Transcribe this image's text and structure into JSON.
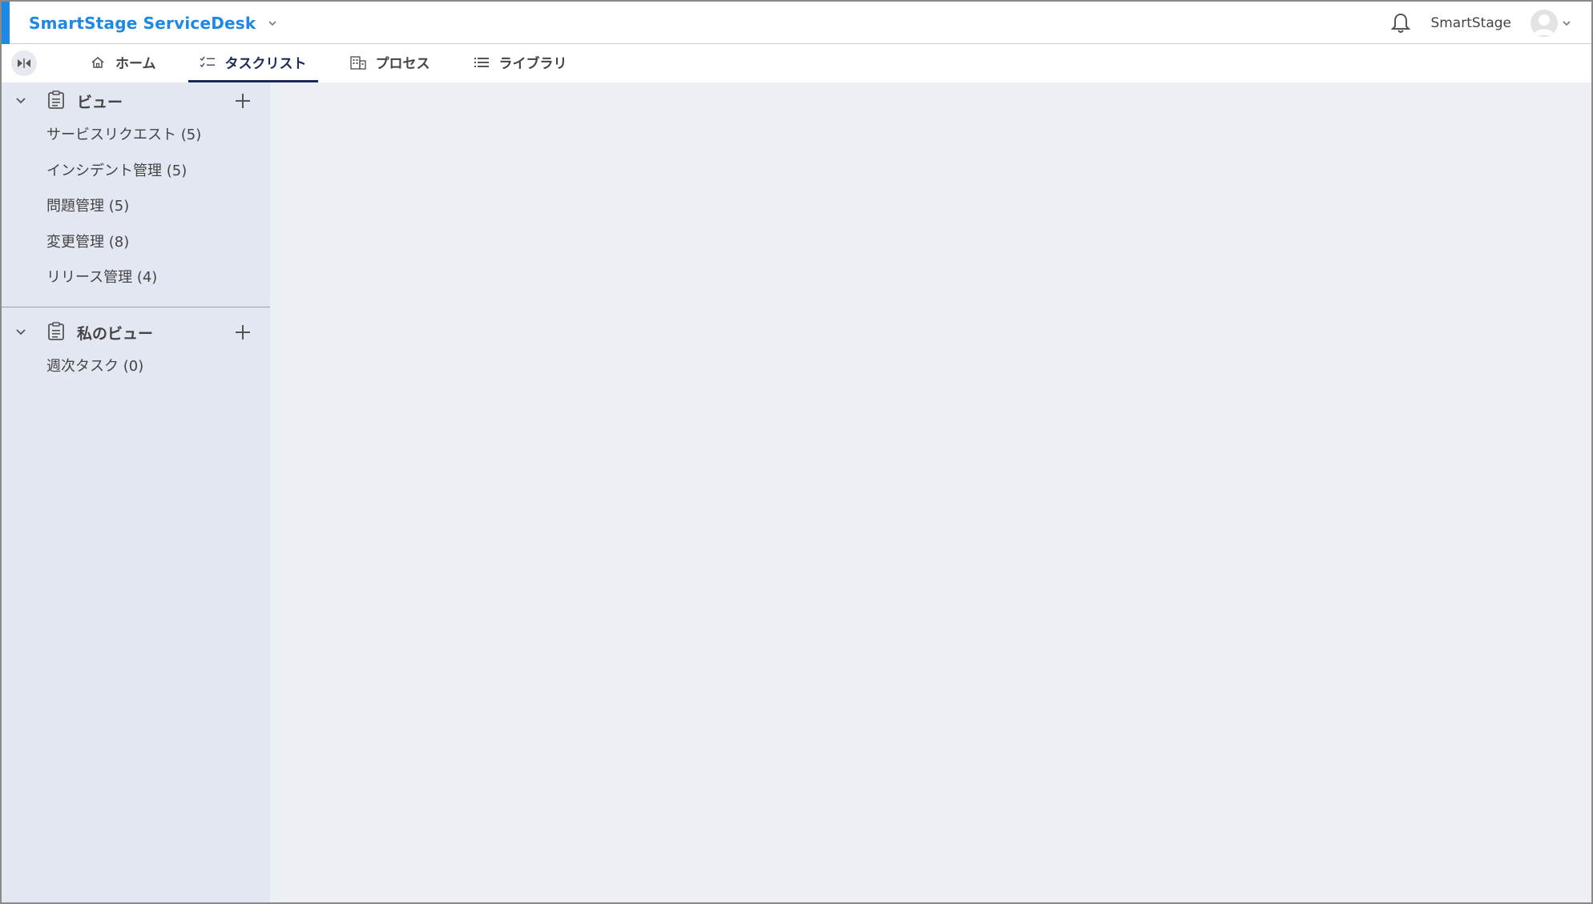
{
  "app": {
    "title": "SmartStage ServiceDesk",
    "accent_color": "#1e88e5"
  },
  "header": {
    "notification_icon": "bell-icon",
    "username": "SmartStage",
    "avatar_icon": "user-avatar-icon"
  },
  "tabs": [
    {
      "label": "ホーム",
      "icon": "home-icon",
      "active": false
    },
    {
      "label": "タスクリスト",
      "icon": "checklist-icon",
      "active": true
    },
    {
      "label": "プロセス",
      "icon": "building-icon",
      "active": false
    },
    {
      "label": "ライブラリ",
      "icon": "list-icon",
      "active": false
    }
  ],
  "sidebar": {
    "sections": [
      {
        "title": "ビュー",
        "items": [
          {
            "label": "サービスリクエスト (5)"
          },
          {
            "label": "インシデント管理 (5)"
          },
          {
            "label": "問題管理 (5)"
          },
          {
            "label": "変更管理 (8)"
          },
          {
            "label": "リリース管理 (4)"
          }
        ]
      },
      {
        "title": "私のビュー",
        "items": [
          {
            "label": "週次タスク (0)"
          }
        ]
      }
    ]
  }
}
